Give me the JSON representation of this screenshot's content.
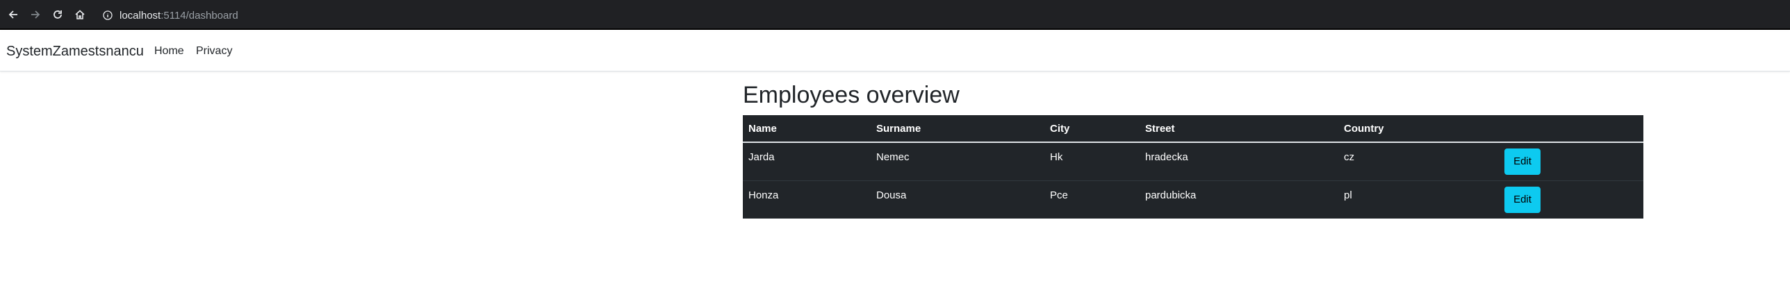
{
  "browser": {
    "url_host": "localhost",
    "url_path": ":5114/dashboard",
    "icons": [
      "back-arrow-icon",
      "forward-arrow-icon",
      "reload-icon",
      "home-icon",
      "info-icon"
    ]
  },
  "navbar": {
    "brand": "SystemZamestsnancu",
    "links": [
      "Home",
      "Privacy"
    ]
  },
  "main": {
    "title": "Employees overview",
    "table": {
      "headers": [
        "Name",
        "Surname",
        "City",
        "Street",
        "Country",
        ""
      ],
      "rows": [
        {
          "name": "Jarda",
          "surname": "Nemec",
          "city": "Hk",
          "street": "hradecka",
          "country": "cz",
          "action": "Edit"
        },
        {
          "name": "Honza",
          "surname": "Dousa",
          "city": "Pce",
          "street": "pardubicka",
          "country": "pl",
          "action": "Edit"
        }
      ]
    }
  },
  "colors": {
    "browser_bar": "#202124",
    "table_bg": "#212529",
    "edit_button": "#0dcaf0"
  }
}
